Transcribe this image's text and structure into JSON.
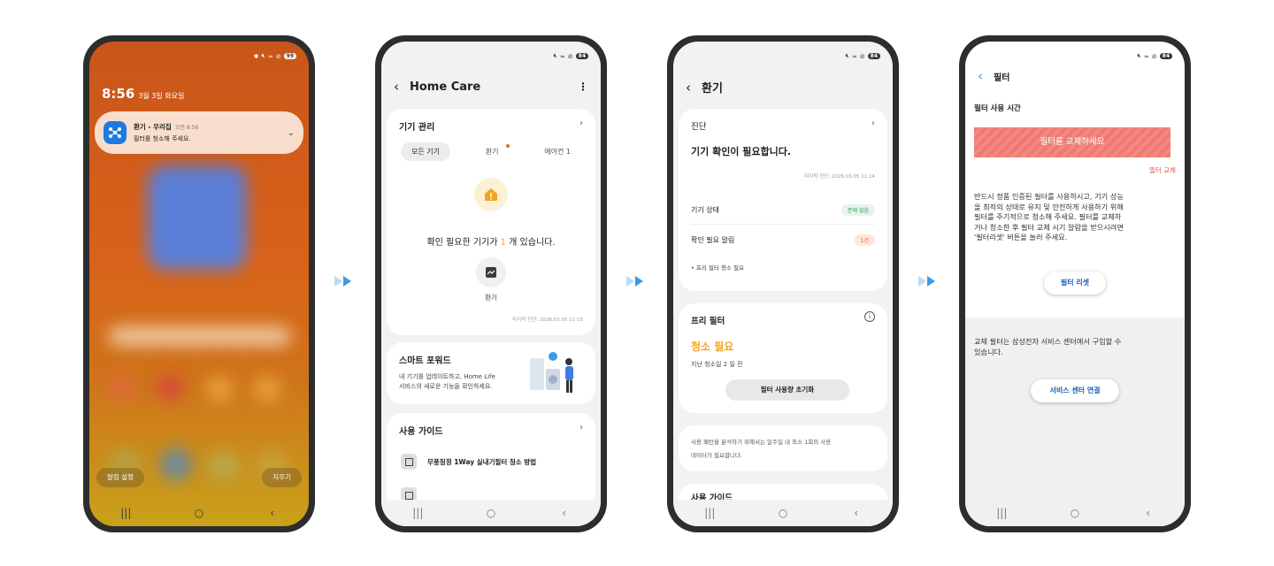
{
  "colors": {
    "accent_blue": "#3d9ae6",
    "warning_yellow": "#f2a41e",
    "alert_red": "#e25a4a",
    "ok_green": "#2d9a5a"
  },
  "status_bar": {
    "battery_light": "99",
    "battery_dark": "84"
  },
  "lock_screen": {
    "time": "8:56",
    "date": "3월 3일 화요일",
    "notification": {
      "title": "환기 - 우리집",
      "time": "오전 8:56",
      "body": "필터를 청소해 주세요."
    },
    "alarm_settings_label": "알림 설정",
    "clear_label": "지우기"
  },
  "home_care": {
    "title": "Home Care",
    "device_mgmt": {
      "title": "기기 관리",
      "tabs": [
        "모든 기기",
        "환기",
        "에어컨 1"
      ],
      "message_pre": "확인 필요한 기기가 ",
      "count": "1",
      "message_post": " 개 있습니다.",
      "device_label": "환기",
      "last_check": "마지막 진단: 2026.03.05 11:15"
    },
    "smart_forward": {
      "title": "스마트 포워드",
      "desc_line1": "내 기기를 업데이트하고, Home Life",
      "desc_line2": "서비스의 새로운 기능을 확인하세요."
    },
    "usage_guide": {
      "title": "사용 가이드",
      "item1": "무풍청정 1Way 실내기필터 청소 방법"
    }
  },
  "ventilation": {
    "title": "환기",
    "diagnosis": {
      "title": "진단",
      "headline": "기기 확인이 필요합니다.",
      "last_check": "마지막 진단: 2026.03.05 11:14",
      "device_status_label": "기기 상태",
      "device_status_value": "문제 없음",
      "alert_label": "확인 필요 알림",
      "alert_value": "1건",
      "alert_item": "• 프리 필터 청소 필요"
    },
    "prefilter": {
      "title": "프리 필터",
      "status": "청소 필요",
      "last_cleaned": "지난 청소일 2 일 전",
      "reset_button": "필터 사용량 초기화"
    },
    "usage_note_line1": "사용 패턴을 분석하기 위해서는 일주일 내 최소 1회의 사용",
    "usage_note_line2": "데이터가 필요합니다.",
    "next_section": "사용 가이드"
  },
  "filter": {
    "title": "필터",
    "usage_time_label": "필터 사용 시간",
    "banner": "필터를 교체하세요",
    "replace_link": "필터 교체",
    "description_lines": [
      "반드시 정품 인증된 필터를 사용하시고, 기기 성능",
      "을 최적의 상태로 유지 및 안전하게 사용하기 위해",
      "필터를 주기적으로 청소해 주세요. 필터를 교체하",
      "거나 청소한 후 필터 교체 시기 알람을 받으시려면",
      "'필터리셋' 버튼을 눌러 주세요."
    ],
    "reset_button": "필터 리셋",
    "purchase_lines": [
      "교체 필터는 삼성전자 서비스 센터에서 구입할 수",
      "있습니다."
    ],
    "service_button": "서비스 센터 연결"
  }
}
